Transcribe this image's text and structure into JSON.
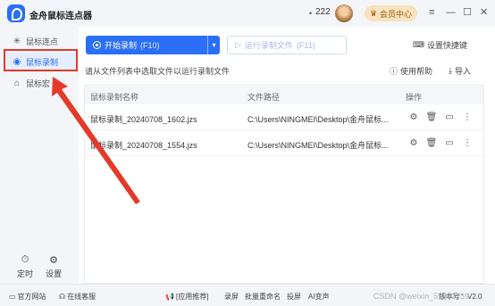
{
  "app": {
    "title": "金舟鼠标连点器",
    "logo_icon": "mouse-logo-icon"
  },
  "header": {
    "coin_count": "222",
    "vip_label": "会员中心"
  },
  "sidebar": {
    "items": [
      {
        "label": "鼠标连点",
        "icon": "click-icon"
      },
      {
        "label": "鼠标录制",
        "icon": "record-icon"
      },
      {
        "label": "鼠标宏",
        "icon": "mouse-icon"
      }
    ],
    "bottom": [
      {
        "label": "定时",
        "icon": "timer-icon"
      },
      {
        "label": "设置",
        "icon": "settings-icon"
      }
    ]
  },
  "toolbar": {
    "record_label": "开始录制",
    "record_hotkey": "(F10)",
    "run_label": "运行录制文件",
    "run_hotkey": "(F11)",
    "hotkey_label": "设置快捷键"
  },
  "main": {
    "hint": "请从文件列表中选取文件以运行录制文件",
    "help_label": "使用帮助",
    "import_label": "导入"
  },
  "table": {
    "headers": {
      "name": "鼠标录制名称",
      "path": "文件路径",
      "actions": "操作"
    },
    "rows": [
      {
        "name": "鼠标录制_20240708_1602.jzs",
        "path": "C:\\Users\\NINGMEI\\Desktop\\金舟鼠标..."
      },
      {
        "name": "鼠标录制_20240708_1554.jzs",
        "path": "C:\\Users\\NINGMEI\\Desktop\\金舟鼠标..."
      }
    ]
  },
  "statusbar": {
    "website": "官方网站",
    "support": "在线客服",
    "promo": "[应用推荐]",
    "links": [
      "录屏",
      "批量重命名",
      "投屏",
      "AI变声"
    ],
    "version_prefix": "版本号：V2.0",
    "watermark": "CSDN @weixin_59971239"
  },
  "colors": {
    "accent": "#2b6ff6",
    "highlight": "#e33a2a",
    "vip_bg": "#f9e2bd"
  }
}
